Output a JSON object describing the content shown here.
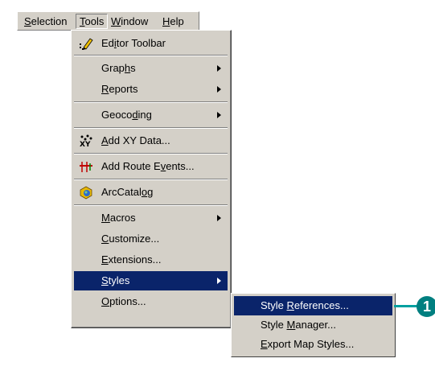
{
  "menubar": {
    "items": [
      {
        "pre": "",
        "u": "S",
        "post": "election"
      },
      {
        "pre": "",
        "u": "T",
        "post": "ools"
      },
      {
        "pre": "",
        "u": "W",
        "post": "indow"
      },
      {
        "pre": "",
        "u": "H",
        "post": "elp"
      }
    ]
  },
  "tools_menu": {
    "items": [
      {
        "pre": "Ed",
        "u": "i",
        "post": "tor Toolbar",
        "icon": "editor-pencil-icon"
      },
      {
        "pre": "Grap",
        "u": "h",
        "post": "s",
        "submenu": true
      },
      {
        "pre": "",
        "u": "R",
        "post": "eports",
        "submenu": true
      },
      {
        "pre": "Geoco",
        "u": "d",
        "post": "ing",
        "submenu": true
      },
      {
        "pre": "",
        "u": "A",
        "post": "dd XY Data...",
        "icon": "xy-data-icon"
      },
      {
        "pre": "Add Route E",
        "u": "v",
        "post": "ents...",
        "icon": "route-events-icon"
      },
      {
        "pre": "ArcCatal",
        "u": "o",
        "post": "g",
        "icon": "arccatalog-icon"
      },
      {
        "pre": "",
        "u": "M",
        "post": "acros",
        "submenu": true
      },
      {
        "pre": "",
        "u": "C",
        "post": "ustomize..."
      },
      {
        "pre": "",
        "u": "E",
        "post": "xtensions..."
      },
      {
        "pre": "",
        "u": "S",
        "post": "tyles",
        "submenu": true,
        "highlighted": true
      },
      {
        "pre": "",
        "u": "O",
        "post": "ptions..."
      }
    ]
  },
  "styles_submenu": {
    "items": [
      {
        "pre": "Style ",
        "u": "R",
        "post": "eferences...",
        "highlighted": true
      },
      {
        "pre": "Style ",
        "u": "M",
        "post": "anager..."
      },
      {
        "pre": "",
        "u": "E",
        "post": "xport Map Styles..."
      }
    ]
  },
  "callout": {
    "number": "1",
    "color": "#007f80"
  },
  "colors": {
    "menu_bg": "#d4d0c8",
    "highlight": "#0a246a"
  }
}
